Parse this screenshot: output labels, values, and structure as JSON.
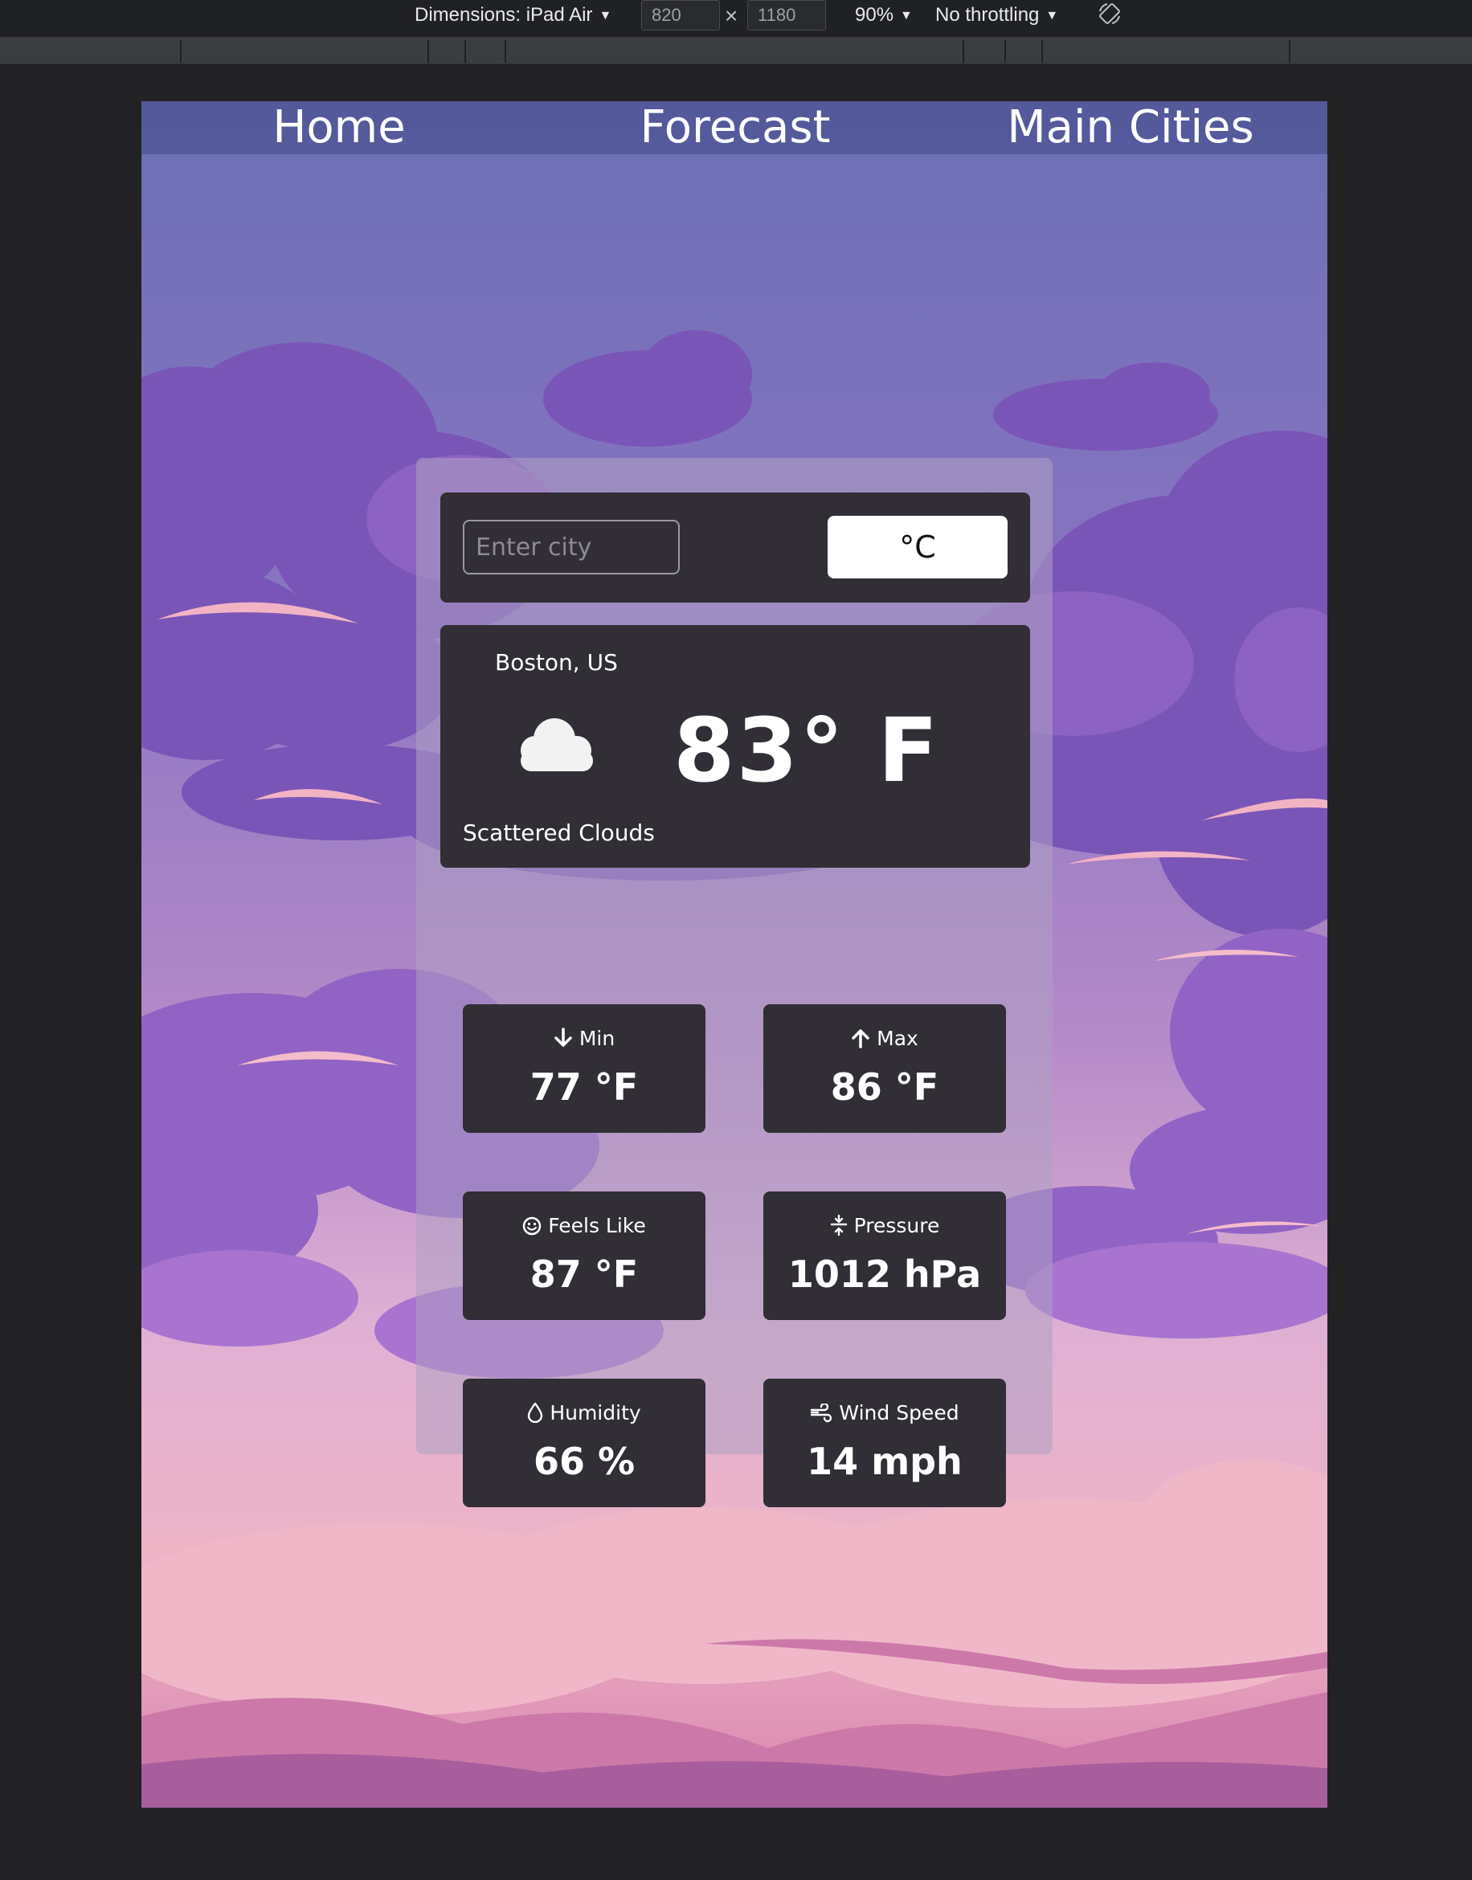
{
  "devtools": {
    "device_label": "Dimensions: iPad Air",
    "width_value": "820",
    "height_value": "1180",
    "zoom_label": "90%",
    "throttling_label": "No throttling"
  },
  "nav": {
    "items": [
      {
        "label": "Home"
      },
      {
        "label": "Forecast"
      },
      {
        "label": "Main Cities"
      }
    ]
  },
  "search": {
    "placeholder": "Enter city",
    "value": "",
    "unit_toggle_label": "°C"
  },
  "current": {
    "location": "Boston, US",
    "temperature": "83° F",
    "condition": "Scattered Clouds",
    "icon": "cloud-icon"
  },
  "stats": {
    "min": {
      "label": "Min",
      "value": "77 °F",
      "icon": "arrow-down-icon"
    },
    "max": {
      "label": "Max",
      "value": "86 °F",
      "icon": "arrow-up-icon"
    },
    "feels_like": {
      "label": "Feels Like",
      "value": "87 °F",
      "icon": "smiley-icon"
    },
    "pressure": {
      "label": "Pressure",
      "value": "1012 hPa",
      "icon": "pressure-icon"
    },
    "humidity": {
      "label": "Humidity",
      "value": "66 %",
      "icon": "droplet-icon"
    },
    "wind_speed": {
      "label": "Wind Speed",
      "value": "14 mph",
      "icon": "wind-icon"
    }
  },
  "colors": {
    "card_background": "#312e36",
    "nav_background": "#505696",
    "sky_top": "#6b6fb5",
    "sky_bottom": "#e9a7c0"
  }
}
